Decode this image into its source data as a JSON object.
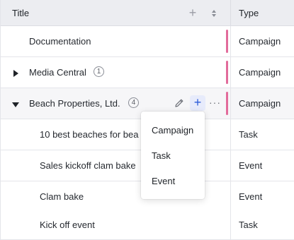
{
  "header": {
    "title_label": "Title",
    "type_label": "Type",
    "add_icon": "plus-icon",
    "sort_icon": "sort-icon"
  },
  "rows": [
    {
      "title": "Documentation",
      "type": "Campaign",
      "has_marker": true
    },
    {
      "title": "Media Central",
      "type": "Campaign",
      "has_marker": true,
      "expander": "collapsed",
      "count": "1"
    },
    {
      "title": "Beach Properties, Ltd.",
      "type": "Campaign",
      "has_marker": true,
      "expander": "expanded",
      "count": "4"
    },
    {
      "title": "10 best beaches for bea",
      "type": "Task"
    },
    {
      "title": "Sales kickoff clam bake",
      "type": "Event"
    },
    {
      "title": "Clam bake",
      "type": "Event"
    },
    {
      "title": "Kick off event",
      "type": "Task"
    }
  ],
  "row_actions": {
    "edit_icon": "pencil-icon",
    "add_icon": "plus-icon",
    "more_icon": "more-icon",
    "more_glyph": "···"
  },
  "add_menu": {
    "items": [
      "Campaign",
      "Task",
      "Event"
    ]
  },
  "colors": {
    "header_bg": "#ecedf1",
    "marker": "#e26b9b",
    "accent": "#2b5bd9",
    "hover_row": "#f6f6f8"
  }
}
